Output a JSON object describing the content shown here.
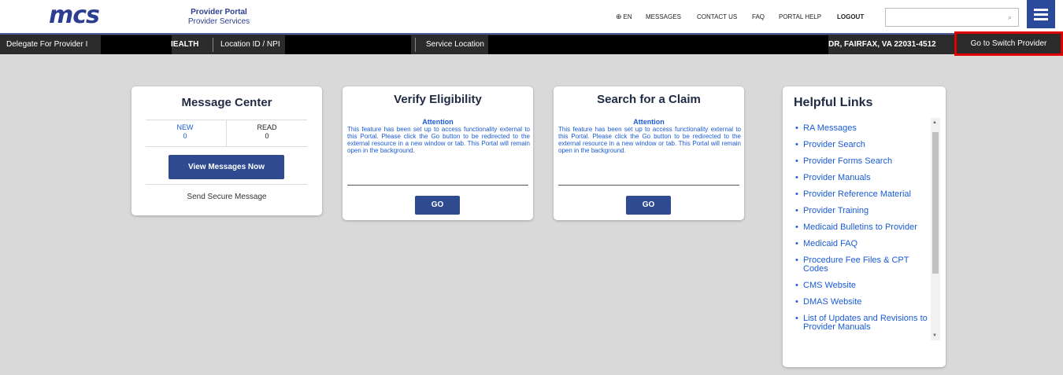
{
  "header": {
    "logo": "mcs",
    "portal_title": "Provider Portal",
    "portal_subtitle": "Provider Services",
    "nav": {
      "language": "EN",
      "messages": "MESSAGES",
      "contact": "CONTACT US",
      "faq": "FAQ",
      "help": "PORTAL HELP",
      "logout": "LOGOUT"
    },
    "search_placeholder": ""
  },
  "infobar": {
    "delegate_label": "Delegate For Provider I",
    "provider_fragment": "IEALTH",
    "location_label": "Location ID / NPI",
    "service_label": "Service Location",
    "address": "DR, FAIRFAX, VA 22031-4512",
    "switch_button": "Go to Switch Provider"
  },
  "message_center": {
    "title": "Message Center",
    "new_label": "NEW",
    "new_count": "0",
    "read_label": "READ",
    "read_count": "0",
    "view_button": "View Messages Now",
    "send_link": "Send Secure Message"
  },
  "verify_eligibility": {
    "title": "Verify Eligibility",
    "attention": "Attention",
    "text": "This feature has been set up to access functionality external to this Portal. Please click the Go button to be redirected to the external resource in a new window or tab. This Portal will remain open in the background.",
    "go_button": "GO"
  },
  "search_claim": {
    "title": "Search for a Claim",
    "attention": "Attention",
    "text": "This feature has been set up to access functionality external to this Portal. Please click the Go button to be redirected to the external resource in a new window or tab. This Portal will remain open in the background.",
    "go_button": "GO"
  },
  "helpful_links": {
    "title": "Helpful Links",
    "items": [
      "RA Messages",
      "Provider Search",
      "Provider Forms Search",
      "Provider Manuals",
      "Provider Reference Material",
      "Provider Training",
      "Medicaid Bulletins to Provider",
      "Medicaid FAQ",
      "Procedure Fee Files & CPT Codes",
      "CMS Website",
      "DMAS Website",
      "List of Updates and Revisions to Provider Manuals"
    ]
  },
  "colors": {
    "brand": "#2c4a9a",
    "link": "#1a5bd6",
    "bar": "#2b2b2b",
    "highlight": "#e00000"
  }
}
